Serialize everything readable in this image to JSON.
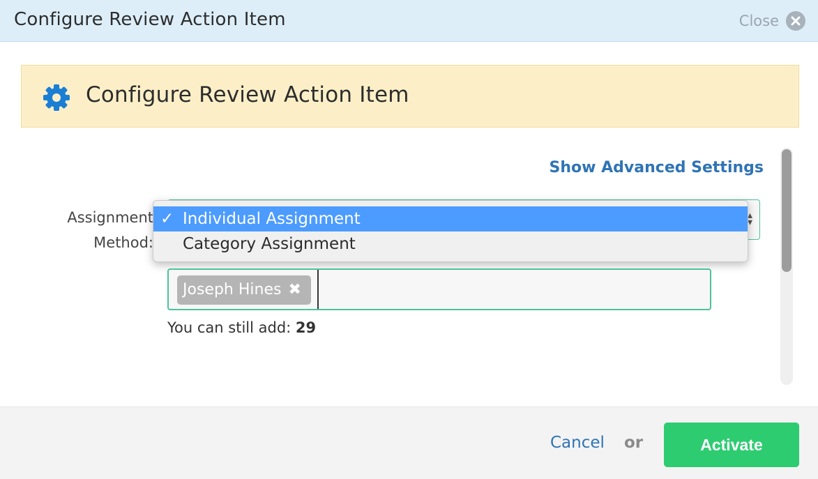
{
  "modal": {
    "title": "Configure Review Action Item",
    "close_label": "Close"
  },
  "banner": {
    "heading": "Configure Review Action Item",
    "icon": "gear-icon"
  },
  "form": {
    "advanced_settings_link": "Show Advanced Settings",
    "assignment_method_label_line1": "Assignment",
    "assignment_method_label_line2": "Method:",
    "assignment_method_options": [
      {
        "label": "Individual Assignment",
        "selected": true,
        "check": "✓"
      },
      {
        "label": "Category Assignment",
        "selected": false,
        "check": ""
      }
    ],
    "assignees": [
      {
        "name": "Joseph Hines",
        "remove_glyph": "✖"
      }
    ],
    "remaining_label": "You can still add: ",
    "remaining_count": "29"
  },
  "footer": {
    "cancel_label": "Cancel",
    "or_label": "or",
    "activate_label": "Activate"
  },
  "colors": {
    "titlebar_bg": "#ddeef9",
    "banner_bg": "#fcefc8",
    "accent_green": "#2ecc71",
    "link_blue": "#2f74b5",
    "selected_option_bg": "#4c9bff",
    "input_border": "#4cc39a"
  }
}
